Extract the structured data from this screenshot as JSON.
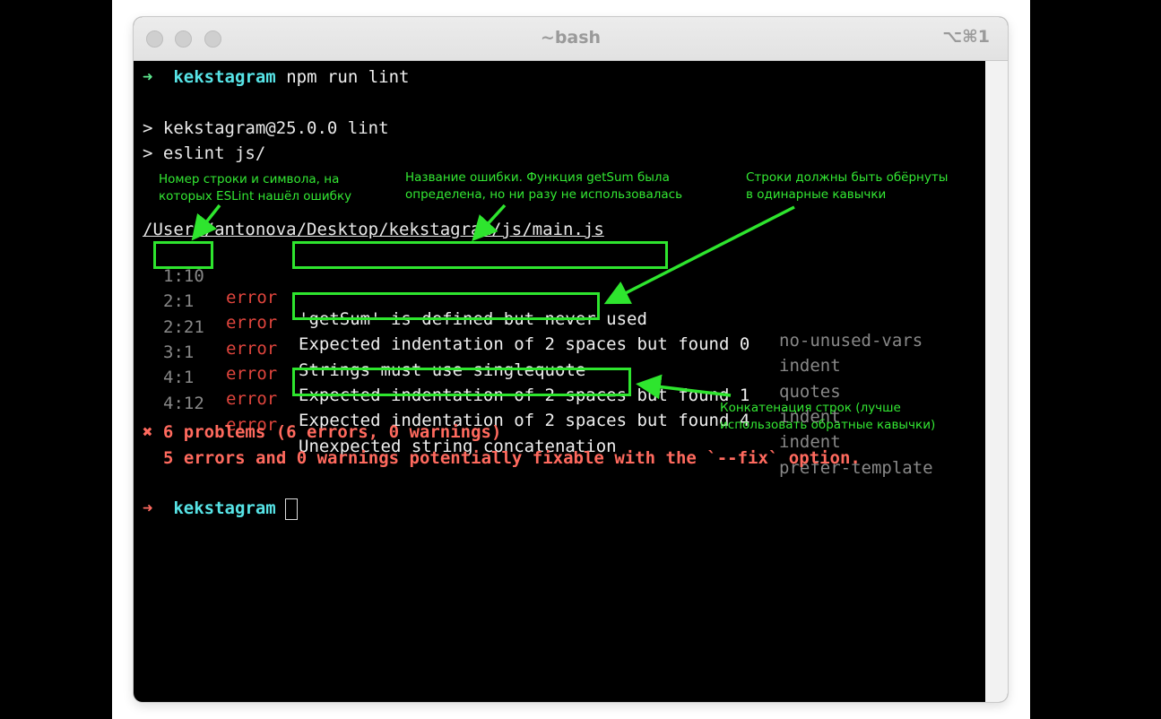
{
  "window": {
    "title": "~bash",
    "shortcut": "⌥⌘1"
  },
  "terminal": {
    "prompt_arrow": "➜",
    "prompt_dir": "kekstagram",
    "command": "npm run lint",
    "script_line_1": "> kekstagram@25.0.0 lint",
    "script_line_2": "> eslint js/",
    "file_path": "/Users/antonova/Desktop/kekstagram/js/main.js",
    "errors": [
      {
        "pos": "1:10",
        "severity": "error",
        "message": "'getSum' is defined but never used",
        "rule": "no-unused-vars"
      },
      {
        "pos": "2:1",
        "severity": "error",
        "message": "Expected indentation of 2 spaces but found 0",
        "rule": "indent"
      },
      {
        "pos": "2:21",
        "severity": "error",
        "message": "Strings must use singlequote",
        "rule": "quotes"
      },
      {
        "pos": "3:1",
        "severity": "error",
        "message": "Expected indentation of 2 spaces but found 1",
        "rule": "indent"
      },
      {
        "pos": "4:1",
        "severity": "error",
        "message": "Expected indentation of 2 spaces but found 4",
        "rule": "indent"
      },
      {
        "pos": "4:12",
        "severity": "error",
        "message": "Unexpected string concatenation",
        "rule": "prefer-template"
      }
    ],
    "summary_icon": "✖",
    "summary": "6 problems (6 errors, 0 warnings)",
    "fixable": "5 errors and 0 warnings potentially fixable with the `--fix` option.",
    "prompt2_arrow": "➜",
    "prompt2_dir": "kekstagram"
  },
  "annotations": {
    "position_note": "Номер строки и символа, на\nкоторых ESLint нашёл ошибку",
    "name_note": "Название ошибки. Функция getSum была\nопределена, но ни разу не использовалась",
    "quotes_note": "Строки должны быть обёрнуты\nв одинарные кавычки",
    "concat_note": "Конкатенация строк (лучше\nиспользовать обратные кавычки)"
  },
  "colors": {
    "annotation_green": "#2ee52e",
    "prompt_green": "#5ee98f",
    "dir_cyan": "#57e3e6",
    "error_red": "#e0453d",
    "summary_red": "#ff6a5e"
  }
}
